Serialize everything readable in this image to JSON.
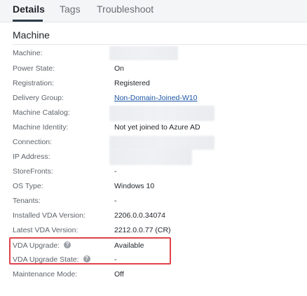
{
  "tabs": [
    {
      "label": "Details",
      "active": true
    },
    {
      "label": "Tags",
      "active": false
    },
    {
      "label": "Troubleshoot",
      "active": false
    }
  ],
  "section": {
    "title": "Machine"
  },
  "properties": [
    {
      "label": "Machine:",
      "value": "",
      "redacted": true
    },
    {
      "label": "Power State:",
      "value": "On"
    },
    {
      "label": "Registration:",
      "value": "Registered"
    },
    {
      "label": "Delivery Group:",
      "value": "Non-Domain-Joined-W10",
      "link": true
    },
    {
      "label": "Machine Catalog:",
      "value": "",
      "redacted": true
    },
    {
      "label": "Machine Identity:",
      "value": "Not yet joined to Azure AD"
    },
    {
      "label": "Connection:",
      "value": "",
      "redacted": true
    },
    {
      "label": "IP Address:",
      "value": "",
      "redacted": true
    },
    {
      "label": "StoreFronts:",
      "value": "-"
    },
    {
      "label": "OS Type:",
      "value": "Windows 10"
    },
    {
      "label": "Tenants:",
      "value": "-"
    },
    {
      "label": "Installed VDA Version:",
      "value": "2206.0.0.34074"
    },
    {
      "label": "Latest VDA Version:",
      "value": "2212.0.0.77 (CR)"
    },
    {
      "label": "VDA Upgrade:",
      "value": "Available",
      "help_icon": "question-mark-icon"
    },
    {
      "label": "VDA Upgrade State:",
      "value": "-",
      "help_icon": "question-mark-icon"
    },
    {
      "label": "Maintenance Mode:",
      "value": "Off"
    }
  ],
  "help_icon_glyph": "?",
  "colors": {
    "highlight_border": "#e0424a",
    "link": "#1b55a6",
    "active_tab_underline": "#2f3d4b"
  }
}
